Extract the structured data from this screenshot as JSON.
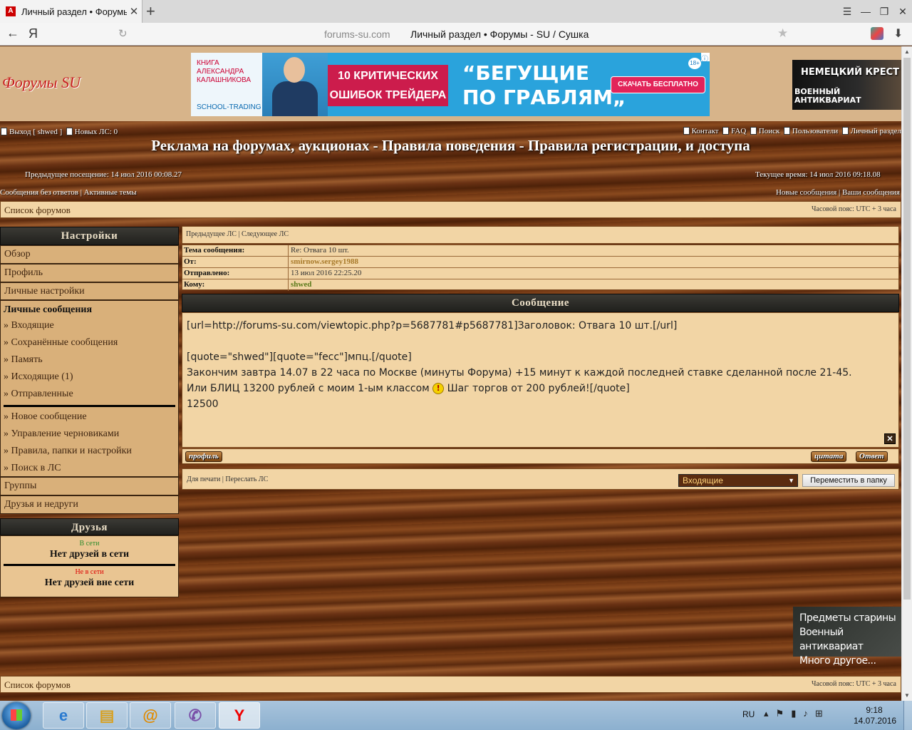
{
  "browser": {
    "tab_title": "Личный раздел • Форумы - SU / Сушка",
    "tab_favicon": "А",
    "new_tab": "+",
    "yandex_logo": "Я",
    "url_host": "forums-su.com",
    "url_title": "Личный раздел • Форумы - SU / Сушка"
  },
  "header": {
    "logo_text": "Форумы",
    "logo_accent": "SU",
    "banner": {
      "book_line1": "КНИГА",
      "book_line2": "АЛЕКСАНДРА",
      "book_line3": "КАЛАШНИКОВА",
      "school": "SCHOOL-TRADING",
      "mid_line1": "10 КРИТИЧЕСКИХ",
      "mid_line2": "ОШИБОК ТРЕЙДЕРА",
      "headline1": "“БЕГУЩИЕ",
      "headline2": "ПО ГРАБЛЯМ„",
      "button": "СКАЧАТЬ БЕСПЛАТНО",
      "age": "18+"
    },
    "ad2_line1": "НЕМЕЦКИЙ КРЕСТ",
    "ad2_line2": "ВОЕННЫЙ",
    "ad2_line3": "АНТИКВАРИАТ"
  },
  "nav": {
    "logout": "Выход [ shwed ]",
    "new_pm": "Новых ЛС: 0",
    "contact": "Контакт",
    "faq": "FAQ",
    "search": "Поиск",
    "users": "Пользователи",
    "personal": "Личный раздел",
    "site_title": "Реклама на форумах, аукционах - Правила поведения - Правила регистрации, и доступа",
    "prev_visit": "Предыдущее посещение: 14 июл 2016 00:08.27",
    "current_time": "Текущее время: 14 июл 2016 09:18.08",
    "unanswered": "Сообщения без ответов",
    "active": "Активные темы",
    "new_posts": "Новые сообщения",
    "your_posts": "Ваши сообщения",
    "sep": "|"
  },
  "breadcrumb": {
    "forum_list": "Список форумов",
    "timezone": "Часовой пояс: UTC + 3 часа"
  },
  "sidebar": {
    "settings_header": "Настройки",
    "overview": "Обзор",
    "profile": "Профиль",
    "personal_settings": "Личные настройки",
    "pm_header": "Личные сообщения",
    "inbox": "» Входящие",
    "saved": "» Сохранённые сообщения",
    "memory": "» Память",
    "outbox": "» Исходящие (1)",
    "sent": "» Отправленные",
    "new_message": "» Новое сообщение",
    "drafts": "» Управление черновиками",
    "rules": "» Правила, папки и настройки",
    "pm_search": "» Поиск в ЛС",
    "groups": "Группы",
    "friends_foes": "Друзья и недруги",
    "friends_header": "Друзья",
    "online_label": "В сети",
    "no_online": "Нет друзей в сети",
    "offline_label": "Не в сети",
    "no_offline": "Нет друзей вне сети"
  },
  "message": {
    "prev_pm": "Предыдущее ЛС",
    "next_pm": "Следующее ЛС",
    "subject_label": "Тема сообщения:",
    "subject": "Re: Отвага 10 шт.",
    "from_label": "От:",
    "from": "smirnow.sergey1988",
    "sent_label": "Отправлено:",
    "sent": "13 июл 2016 22:25.20",
    "to_label": "Кому:",
    "to": "shwed",
    "body_header": "Сообщение",
    "line1": "[url=http://forums-su.com/viewtopic.php?p=5687781#p5687781]Заголовок: Отвага 10 шт.[/url]",
    "line2": "[quote=\"shwed\"][quote=\"fecc\"]мпц.[/quote]",
    "line3": "Закончим завтра 14.07 в 22 часа по Москве (минуты Форума) +15 минут к каждой последней ставке сделанной после 21-45.",
    "line4a": "Или БЛИЦ 13200 рублей с моим 1-ым классом",
    "line4b": "Шаг торгов от 200 рублей![/quote]",
    "line5": "12500",
    "smiley": "!",
    "delete_icon": "✕",
    "profile_btn": "профиль",
    "quote_btn": "цитата",
    "reply_btn": "Ответ",
    "print": "Для печати",
    "forward": "Переслать ЛС",
    "folder_selected": "Входящие",
    "move_btn": "Переместить в папку"
  },
  "ad3": {
    "line1": "Предметы старины",
    "line2": "Военный антиквариат",
    "line3": "Много другое..."
  },
  "taskbar": {
    "lang": "RU",
    "time": "9:18",
    "date": "14.07.2016"
  }
}
